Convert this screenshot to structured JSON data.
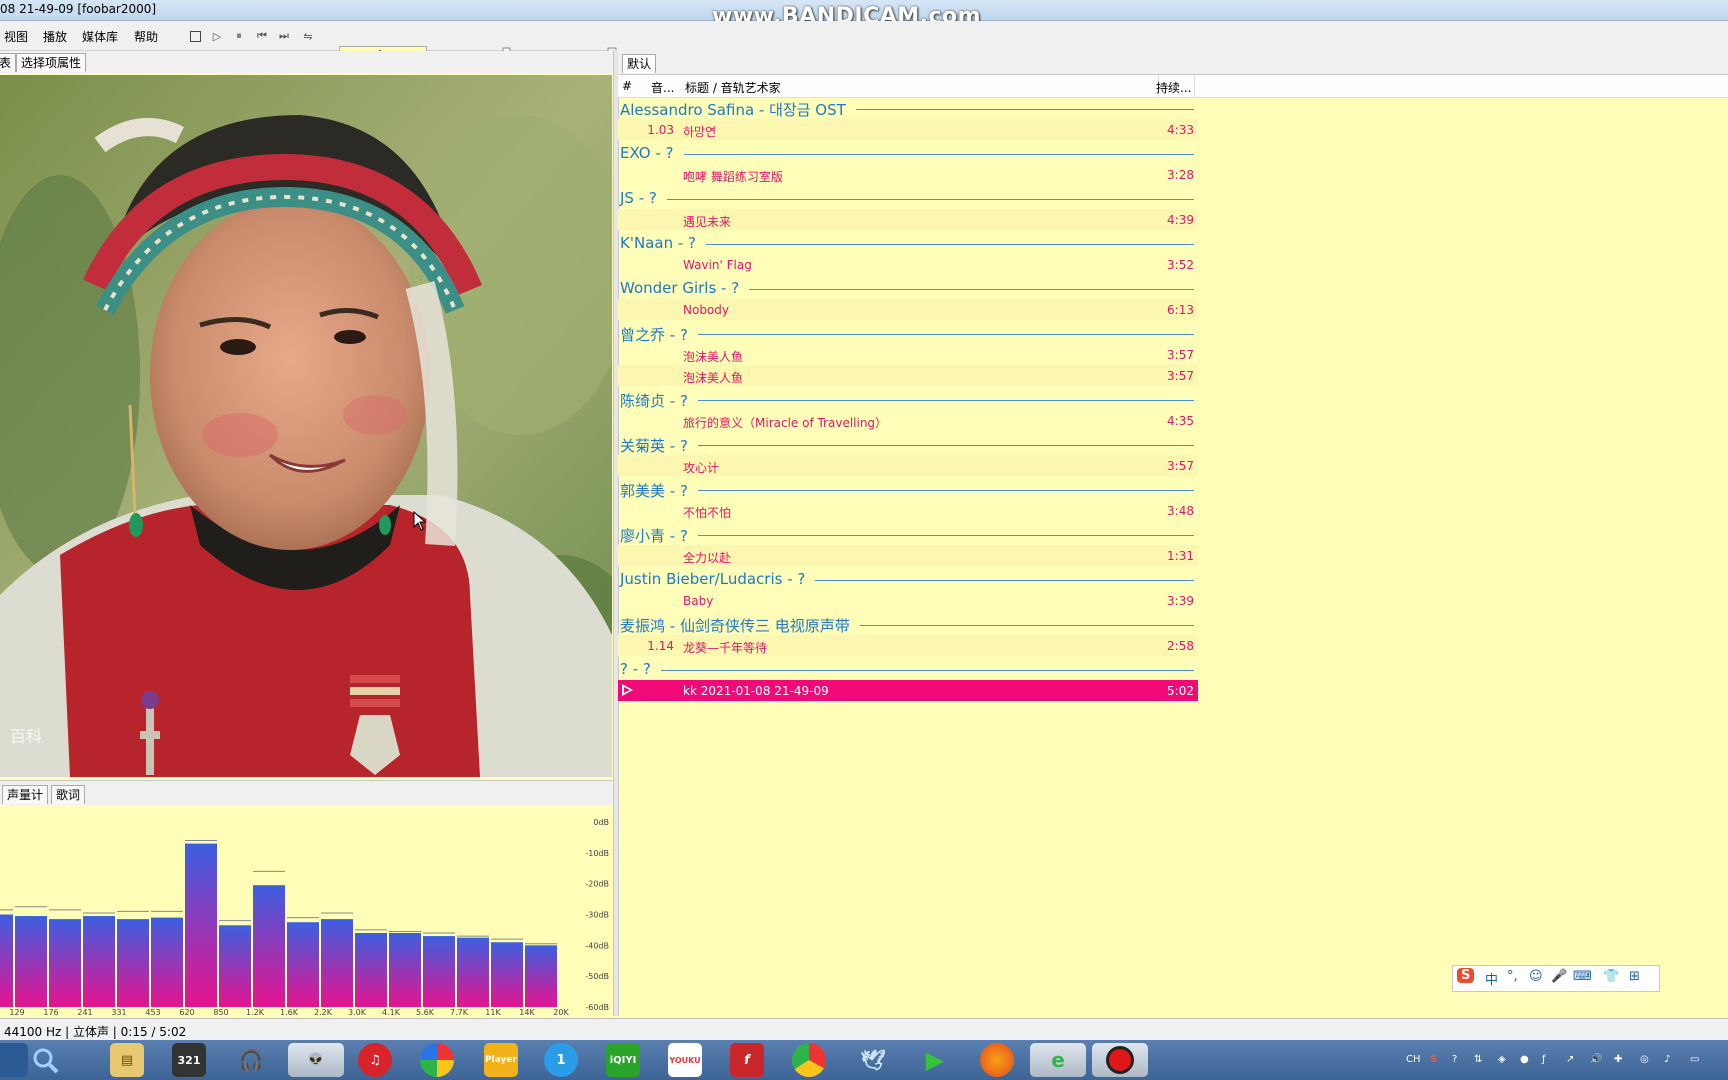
{
  "window": {
    "title": "08 21-49-09  [foobar2000]"
  },
  "watermark": "www.BANDICAM.com",
  "menu": [
    "视图",
    "播放",
    "媒体库",
    "帮助"
  ],
  "left_tabs": [
    "表",
    "选择项属性"
  ],
  "bottom_tabs": [
    "声量计",
    "歌词"
  ],
  "spectrum": {
    "db_labels": [
      "0dB",
      "-10dB",
      "-20dB",
      "-30dB",
      "-40dB",
      "-50dB",
      "-60dB"
    ],
    "freq_labels": [
      "129",
      "176",
      "241",
      "331",
      "453",
      "620",
      "850",
      "1.2K",
      "1.6K",
      "2.2K",
      "3.0K",
      "4.1K",
      "5.6K",
      "7.7K",
      "11K",
      "14K",
      "20K"
    ],
    "levels_db": [
      -30,
      -30.5,
      -31.5,
      -30.5,
      -31.5,
      -31,
      -7,
      -33.5,
      -20.5,
      -32.5,
      -31.5,
      -36,
      -36,
      -37,
      -37.5,
      -39,
      -40
    ],
    "peaks_db": [
      -28.5,
      -27.5,
      -28.5,
      -29.5,
      -29,
      -29,
      -6,
      -32,
      -16,
      -31,
      -29.5,
      -35,
      -35.5,
      -36,
      -37,
      -38,
      -39.5
    ],
    "colors": {
      "top": "#3b5fe0",
      "bottom": "#e8138f"
    }
  },
  "right_tabs": [
    "默认"
  ],
  "playlist_header": {
    "col1": "#",
    "col2": "音...",
    "col3": "标题 / 音轨艺术家",
    "col4": "持续..."
  },
  "playlist": [
    {
      "group": "Alessandro Safina - 대장금 OST",
      "tracks": [
        {
          "num": "1.03",
          "title": "하망연",
          "duration": "4:33"
        }
      ]
    },
    {
      "group": "EXO - ?",
      "tracks": [
        {
          "num": "",
          "title": "咆哮 舞蹈练习室版",
          "duration": "3:28"
        }
      ]
    },
    {
      "group": "JS - ?",
      "tracks": [
        {
          "num": "",
          "title": "遇见未来",
          "duration": "4:39"
        }
      ]
    },
    {
      "group": "K'Naan - ?",
      "tracks": [
        {
          "num": "",
          "title": "Wavin' Flag",
          "duration": "3:52"
        }
      ]
    },
    {
      "group": "Wonder Girls - ?",
      "tracks": [
        {
          "num": "",
          "title": "Nobody",
          "duration": "6:13"
        }
      ]
    },
    {
      "group": "曾之乔 - ?",
      "tracks": [
        {
          "num": "",
          "title": "泡沫美人鱼",
          "duration": "3:57"
        },
        {
          "num": "",
          "title": "泡沫美人鱼",
          "duration": "3:57"
        }
      ]
    },
    {
      "group": "陈绮贞 - ?",
      "tracks": [
        {
          "num": "",
          "title": "旅行的意义（Miracle of Travelling）",
          "duration": "4:35"
        }
      ]
    },
    {
      "group": "关菊英 - ?",
      "tracks": [
        {
          "num": "",
          "title": "攻心计",
          "duration": "3:57"
        }
      ]
    },
    {
      "group": "郭美美 - ?",
      "tracks": [
        {
          "num": "",
          "title": "不怕不怕",
          "duration": "3:48"
        }
      ]
    },
    {
      "group": "廖小青 - ?",
      "tracks": [
        {
          "num": "",
          "title": "全力以赴",
          "duration": "1:31"
        }
      ]
    },
    {
      "group": "Justin Bieber/Ludacris - ?",
      "tracks": [
        {
          "num": "",
          "title": "Baby",
          "duration": "3:39"
        }
      ]
    },
    {
      "group": "麦振鸿 - 仙剑奇侠传三 电视原声带",
      "tracks": [
        {
          "num": "1.14",
          "title": "龙葵—千年等待",
          "duration": "2:58"
        }
      ]
    },
    {
      "group": "? - ?",
      "tracks": [
        {
          "num": "",
          "title": "kk 2021-01-08 21-49-09",
          "duration": "5:02",
          "playing": true
        }
      ]
    }
  ],
  "ime": {
    "logo": "S",
    "items": [
      "中",
      "°,",
      "☺",
      "🎤",
      "⌨",
      "👕",
      "⊞"
    ]
  },
  "status": {
    "text": "44100 Hz | 立体声 | 0:15 / 5:02"
  },
  "photo": {
    "watermark": "百科"
  },
  "taskbar": {
    "apps": [
      "search",
      "explorer",
      "321",
      "headphones",
      "alien",
      "netease",
      "pinwheel",
      "Player",
      "one",
      "iQIYI",
      "YOUKU",
      "flash",
      "chrome",
      "bird",
      "play",
      "firefox",
      "ie",
      "record"
    ],
    "tray": [
      "CH",
      "S"
    ]
  },
  "colors": {
    "playlist_bg": "#fefeb8",
    "group": "#1f78c8",
    "track": "#e5166b",
    "playing": "#ef0a78"
  }
}
